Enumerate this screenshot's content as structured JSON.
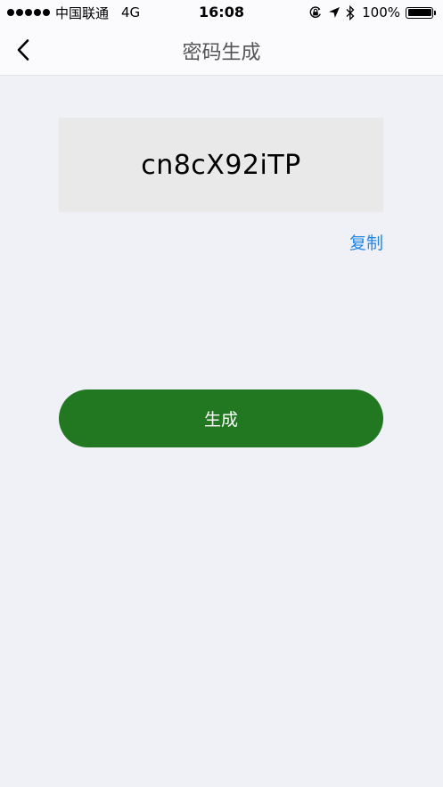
{
  "status_bar": {
    "carrier": "中国联通",
    "network": "4G",
    "time": "16:08",
    "battery_percent": "100%",
    "battery_level": 1.0,
    "icons": [
      "signal-dots-icon",
      "orientation-lock-icon",
      "location-arrow-icon",
      "bluetooth-icon",
      "battery-icon"
    ]
  },
  "nav": {
    "title": "密码生成",
    "back_icon": "chevron-left-icon"
  },
  "password": {
    "value": "cn8cX92iTP"
  },
  "actions": {
    "copy_label": "复制",
    "generate_label": "生成"
  },
  "colors": {
    "background": "#f0f1f6",
    "bar_background": "#fbfbfd",
    "password_box": "#e9e9e9",
    "link": "#1f86e8",
    "button": "#227721",
    "button_text": "#ffffff"
  }
}
